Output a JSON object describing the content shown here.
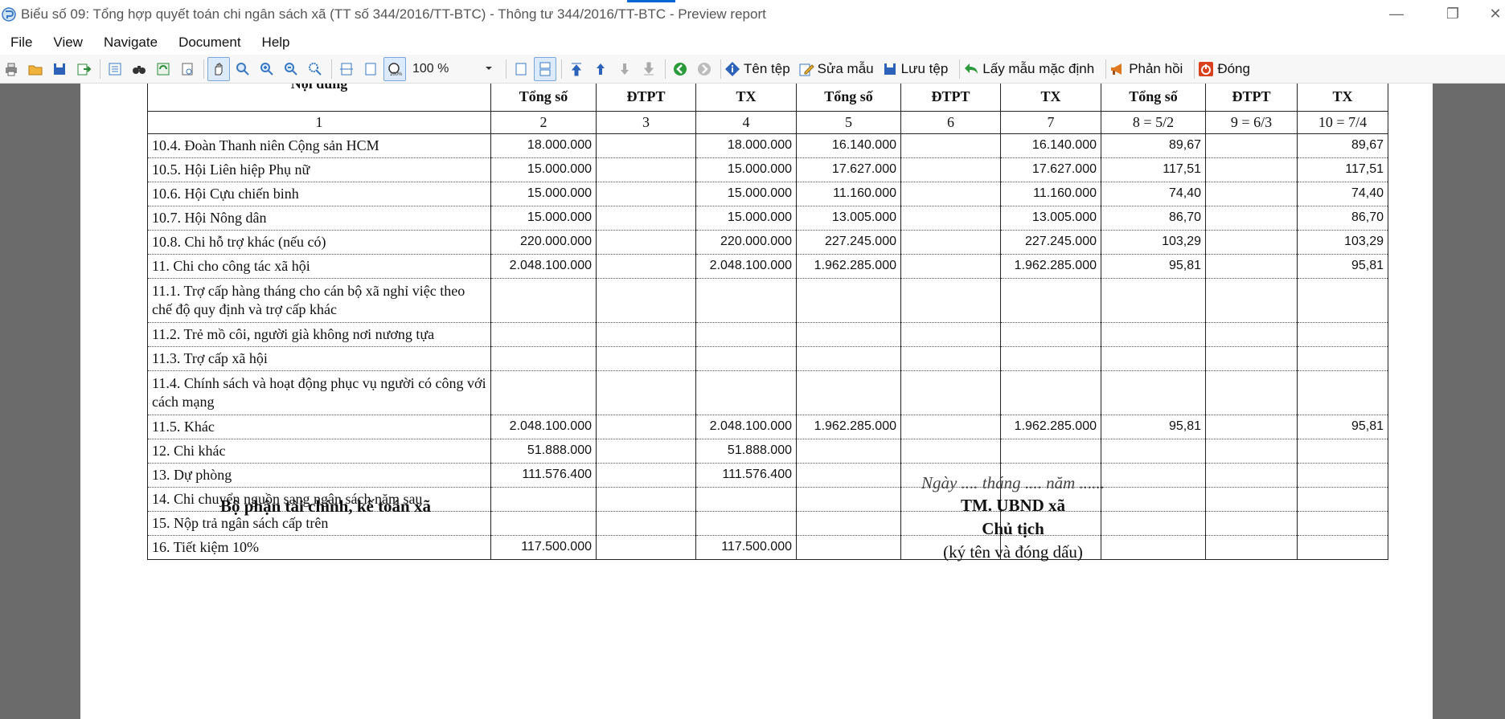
{
  "window": {
    "title": "Biểu số 09: Tổng hợp quyết toán chi ngân sách xã (TT số 344/2016/TT-BTC) - Thông tư 344/2016/TT-BTC  - Preview report",
    "minimize": "—",
    "restore": "❐",
    "close": "✕"
  },
  "menu": [
    "File",
    "View",
    "Navigate",
    "Document",
    "Help"
  ],
  "toolbar": {
    "zoom_value": "100 %",
    "buttons": {
      "file_name": "Tên tệp",
      "edit_template": "Sửa mẫu",
      "save_file": "Lưu tệp",
      "default_template": "Lấy mẫu mặc định",
      "feedback": "Phản hồi",
      "close": "Đóng"
    }
  },
  "table": {
    "partial_header": "Nội dung",
    "headers": [
      "Tổng số",
      "ĐTPT",
      "TX",
      "Tổng số",
      "ĐTPT",
      "TX",
      "Tổng số",
      "ĐTPT",
      "TX"
    ],
    "col_numbers": [
      "1",
      "2",
      "3",
      "4",
      "5",
      "6",
      "7",
      "8 = 5/2",
      "9 = 6/3",
      "10 = 7/4"
    ],
    "rows": [
      [
        "10.4. Đoàn Thanh niên Cộng sản HCM",
        "18.000.000",
        "",
        "18.000.000",
        "16.140.000",
        "",
        "16.140.000",
        "89,67",
        "",
        "89,67"
      ],
      [
        "10.5. Hội Liên hiệp Phụ nữ",
        "15.000.000",
        "",
        "15.000.000",
        "17.627.000",
        "",
        "17.627.000",
        "117,51",
        "",
        "117,51"
      ],
      [
        "10.6. Hội Cựu chiến binh",
        "15.000.000",
        "",
        "15.000.000",
        "11.160.000",
        "",
        "11.160.000",
        "74,40",
        "",
        "74,40"
      ],
      [
        "10.7. Hội Nông dân",
        "15.000.000",
        "",
        "15.000.000",
        "13.005.000",
        "",
        "13.005.000",
        "86,70",
        "",
        "86,70"
      ],
      [
        "10.8. Chi hỗ trợ khác (nếu có)",
        "220.000.000",
        "",
        "220.000.000",
        "227.245.000",
        "",
        "227.245.000",
        "103,29",
        "",
        "103,29"
      ],
      [
        "11. Chi cho công tác xã hội",
        "2.048.100.000",
        "",
        "2.048.100.000",
        "1.962.285.000",
        "",
        "1.962.285.000",
        "95,81",
        "",
        "95,81"
      ],
      [
        "11.1. Trợ cấp hàng tháng cho cán bộ xã nghỉ việc theo chế độ quy định và trợ cấp khác",
        "",
        "",
        "",
        "",
        "",
        "",
        "",
        "",
        ""
      ],
      [
        "11.2. Trẻ mồ côi, người già không nơi nương tựa",
        "",
        "",
        "",
        "",
        "",
        "",
        "",
        "",
        ""
      ],
      [
        "11.3. Trợ cấp xã hội",
        "",
        "",
        "",
        "",
        "",
        "",
        "",
        "",
        ""
      ],
      [
        "11.4. Chính sách và hoạt động phục vụ người có công với cách mạng",
        "",
        "",
        "",
        "",
        "",
        "",
        "",
        "",
        ""
      ],
      [
        "11.5. Khác",
        "2.048.100.000",
        "",
        "2.048.100.000",
        "1.962.285.000",
        "",
        "1.962.285.000",
        "95,81",
        "",
        "95,81"
      ],
      [
        "12. Chi khác",
        "51.888.000",
        "",
        "51.888.000",
        "",
        "",
        "",
        "",
        "",
        ""
      ],
      [
        "13. Dự phòng",
        "111.576.400",
        "",
        "111.576.400",
        "",
        "",
        "",
        "",
        "",
        ""
      ],
      [
        "14. Chi chuyển nguồn sang ngân sách năm sau",
        "",
        "",
        "",
        "",
        "",
        "",
        "",
        "",
        ""
      ],
      [
        "15. Nộp trả ngân sách cấp trên",
        "",
        "",
        "",
        "",
        "",
        "",
        "",
        "",
        ""
      ],
      [
        "16. Tiết kiệm 10%",
        "117.500.000",
        "",
        "117.500.000",
        "",
        "",
        "",
        "",
        "",
        ""
      ]
    ]
  },
  "signature": {
    "left_title": "Bộ phận tài chính, kế toán xã",
    "date_line": "Ngày .... tháng .... năm ......",
    "org": "TM. UBND xã",
    "position": "Chủ tịch",
    "note": "(ký tên và đóng dấu)"
  }
}
